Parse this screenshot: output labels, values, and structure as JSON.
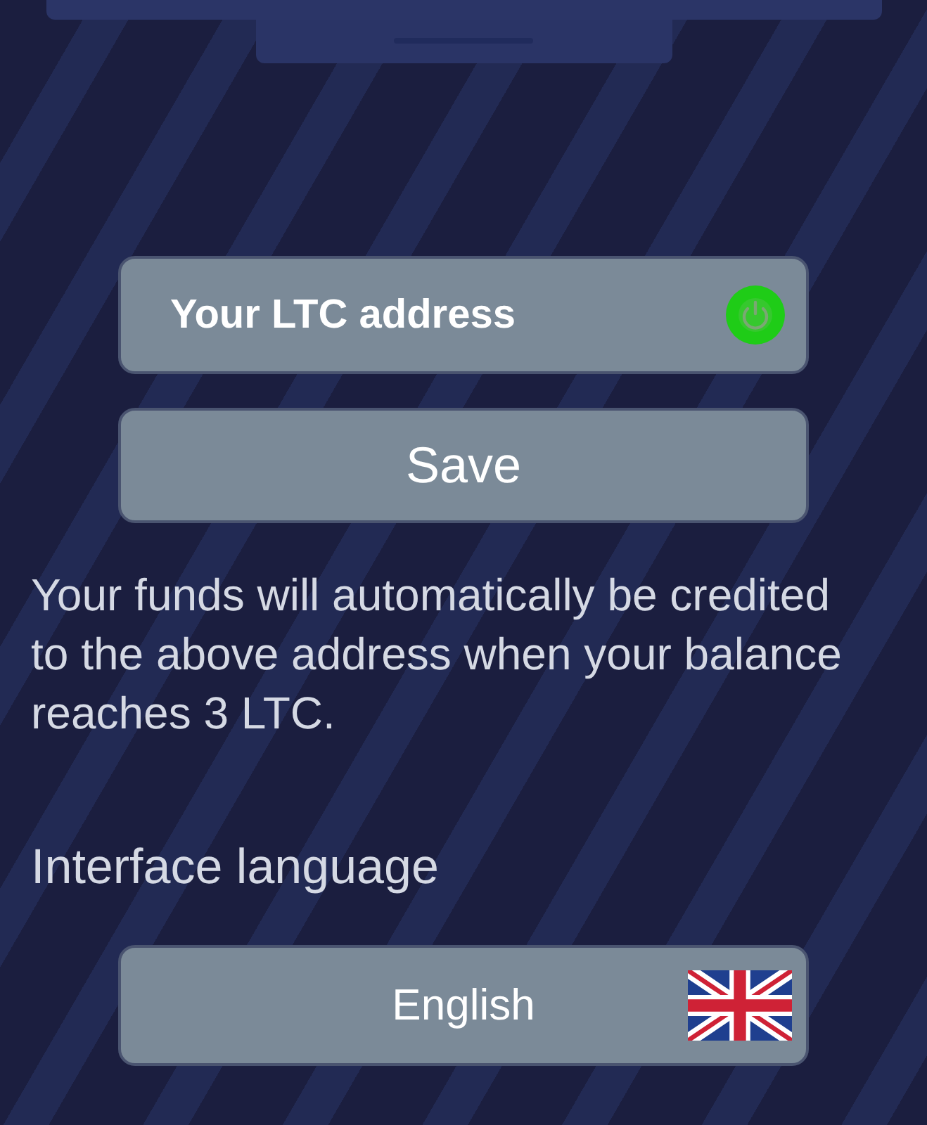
{
  "address_field": {
    "placeholder": "Your LTC address"
  },
  "save_button": {
    "label": "Save"
  },
  "payout_note": "Your funds will automatically be credited to the above address when your balance reaches 3 LTC.",
  "language": {
    "heading": "Interface language",
    "value": "English"
  }
}
